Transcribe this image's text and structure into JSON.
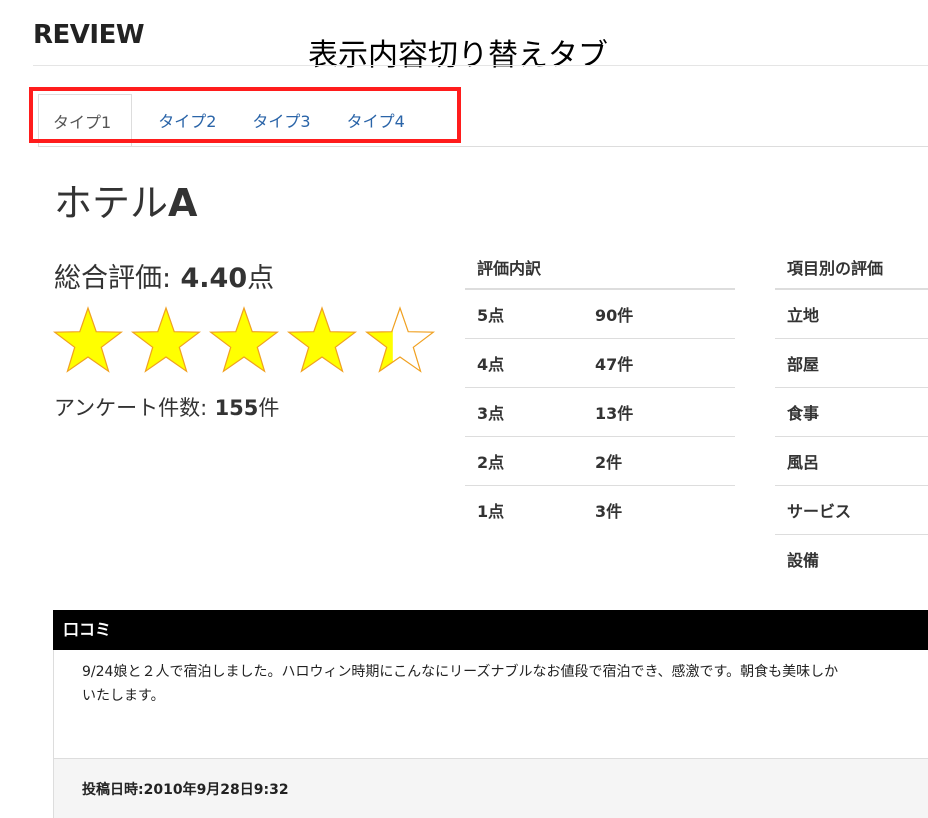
{
  "page": {
    "heading": "REVIEW",
    "annotation": "表示内容切り替えタブ"
  },
  "tabs": [
    {
      "label": "タイプ1",
      "active": true
    },
    {
      "label": "タイプ2",
      "active": false
    },
    {
      "label": "タイプ3",
      "active": false
    },
    {
      "label": "タイプ4",
      "active": false
    }
  ],
  "colors": {
    "highlight": "#ff1c1c",
    "link": "#2a64a8",
    "star_fill": "#ffff00",
    "star_stroke": "#f0a020"
  },
  "hotel": {
    "name_prefix": "ホテル",
    "name_suffix": "A"
  },
  "overall": {
    "label": "総合評価:",
    "score": "4.40",
    "unit": "点",
    "rating": 4.4,
    "max": 5,
    "survey_label": "アンケート件数:",
    "survey_count": "155",
    "survey_unit": "件"
  },
  "breakdown": {
    "header": "評価内訳",
    "rows": [
      {
        "score": "5点",
        "count": "90件"
      },
      {
        "score": "4点",
        "count": "47件"
      },
      {
        "score": "3点",
        "count": "13件"
      },
      {
        "score": "2点",
        "count": "2件"
      },
      {
        "score": "1点",
        "count": "3件"
      }
    ]
  },
  "items": {
    "header": "項目別の評価",
    "rows": [
      "立地",
      "部屋",
      "食事",
      "風呂",
      "サービス",
      "設備"
    ]
  },
  "comments": {
    "header": "口コミ",
    "text": "9/24娘と２人で宿泊しました。ハロウィン時期にこんなにリーズナブルなお値段で宿泊でき、感激です。朝食も美味しか\nいたします。",
    "posted": "投稿日時:2010年9月28日9:32"
  }
}
